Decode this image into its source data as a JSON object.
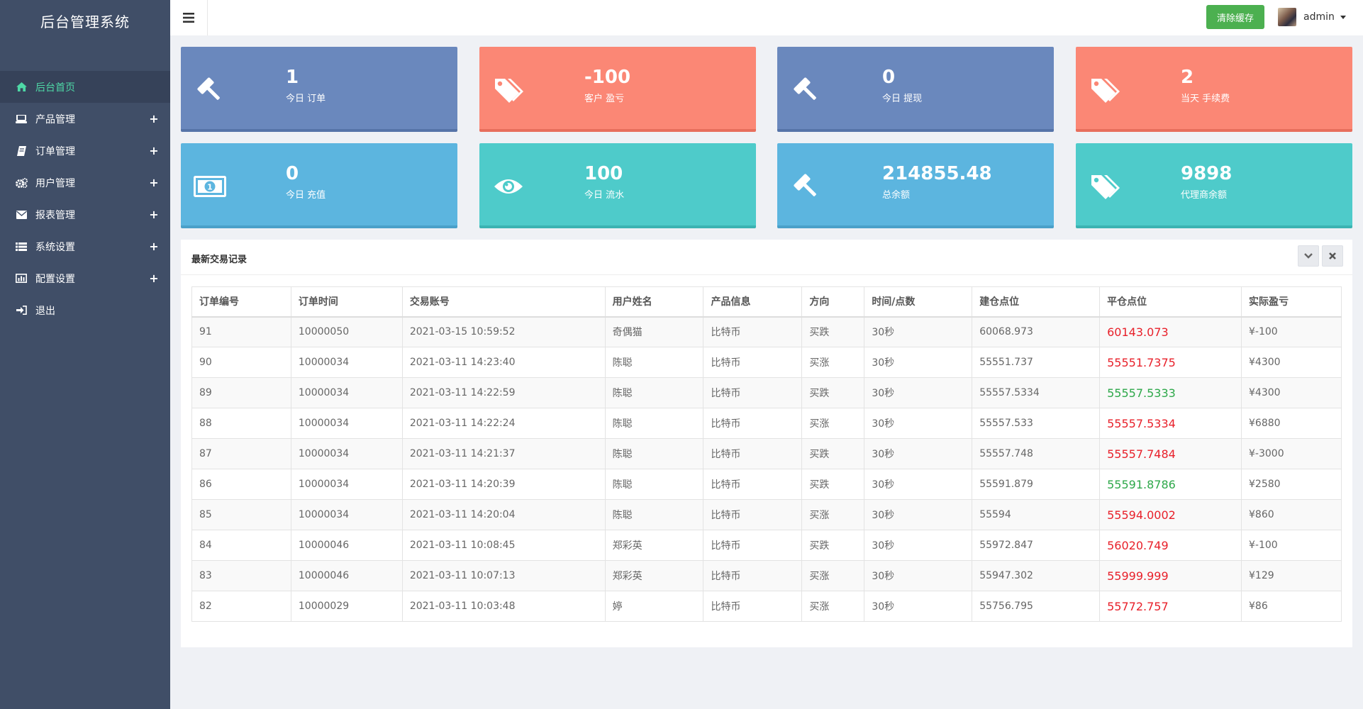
{
  "brand": "后台管理系统",
  "sidebar": {
    "items": [
      {
        "label": "后台首页",
        "icon": "home-icon",
        "active": true,
        "expandable": false
      },
      {
        "label": "产品管理",
        "icon": "laptop-icon",
        "active": false,
        "expandable": true
      },
      {
        "label": "订单管理",
        "icon": "book-icon",
        "active": false,
        "expandable": true
      },
      {
        "label": "用户管理",
        "icon": "gears-icon",
        "active": false,
        "expandable": true
      },
      {
        "label": "报表管理",
        "icon": "envelope-icon",
        "active": false,
        "expandable": true
      },
      {
        "label": "系统设置",
        "icon": "list-icon",
        "active": false,
        "expandable": true
      },
      {
        "label": "配置设置",
        "icon": "bar-chart-icon",
        "active": false,
        "expandable": true
      },
      {
        "label": "退出",
        "icon": "sign-out-icon",
        "active": false,
        "expandable": false
      }
    ],
    "plus": "+"
  },
  "header": {
    "clear_cache": "清除缓存",
    "username": "admin"
  },
  "cards": [
    {
      "value": "1",
      "label": "今日 订单",
      "icon": "gavel-icon",
      "color": "blue"
    },
    {
      "value": "-100",
      "label": "客户 盈亏",
      "icon": "tags-icon",
      "color": "salmon"
    },
    {
      "value": "0",
      "label": "今日 提现",
      "icon": "gavel-icon",
      "color": "blue"
    },
    {
      "value": "2",
      "label": "当天 手续费",
      "icon": "tags-icon",
      "color": "salmon"
    },
    {
      "value": "0",
      "label": "今日 充值",
      "icon": "money-icon",
      "color": "sky"
    },
    {
      "value": "100",
      "label": "今日 流水",
      "icon": "eye-icon",
      "color": "teal"
    },
    {
      "value": "214855.48",
      "label": "总余额",
      "icon": "gavel-icon",
      "color": "sky"
    },
    {
      "value": "9898",
      "label": "代理商余额",
      "icon": "tags-icon",
      "color": "teal"
    }
  ],
  "colors": {
    "sidebar_bg": "#404e67",
    "active_text": "#4ed8a6",
    "blue": "#6a88bd",
    "salmon": "#fb8775",
    "sky": "#5cb5df",
    "teal": "#4ecbca",
    "button_green": "#4cb050",
    "loss_red": "#e8202a",
    "gain_green": "#2ea84a"
  },
  "panel": {
    "title": "最新交易记录",
    "columns": [
      "订单编号",
      "订单时间",
      "交易账号",
      "用户姓名",
      "产品信息",
      "方向",
      "时间/点数",
      "建仓点位",
      "平仓点位",
      "实际盈亏"
    ],
    "rows": [
      [
        "91",
        "10000050",
        "2021-03-15 10:59:52",
        "奇偶猫",
        "比特币",
        "买跌",
        "30秒",
        "60068.973",
        "60143.073",
        "¥-100"
      ],
      [
        "90",
        "10000034",
        "2021-03-11 14:23:40",
        "陈聪",
        "比特币",
        "买涨",
        "30秒",
        "55551.737",
        "55551.7375",
        "¥4300"
      ],
      [
        "89",
        "10000034",
        "2021-03-11 14:22:59",
        "陈聪",
        "比特币",
        "买跌",
        "30秒",
        "55557.5334",
        "55557.5333",
        "¥4300"
      ],
      [
        "88",
        "10000034",
        "2021-03-11 14:22:24",
        "陈聪",
        "比特币",
        "买涨",
        "30秒",
        "55557.533",
        "55557.5334",
        "¥6880"
      ],
      [
        "87",
        "10000034",
        "2021-03-11 14:21:37",
        "陈聪",
        "比特币",
        "买跌",
        "30秒",
        "55557.748",
        "55557.7484",
        "¥-3000"
      ],
      [
        "86",
        "10000034",
        "2021-03-11 14:20:39",
        "陈聪",
        "比特币",
        "买跌",
        "30秒",
        "55591.879",
        "55591.8786",
        "¥2580"
      ],
      [
        "85",
        "10000034",
        "2021-03-11 14:20:04",
        "陈聪",
        "比特币",
        "买涨",
        "30秒",
        "55594",
        "55594.0002",
        "¥860"
      ],
      [
        "84",
        "10000046",
        "2021-03-11 10:08:45",
        "郑彩英",
        "比特币",
        "买跌",
        "30秒",
        "55972.847",
        "56020.749",
        "¥-100"
      ],
      [
        "83",
        "10000046",
        "2021-03-11 10:07:13",
        "郑彩英",
        "比特币",
        "买涨",
        "30秒",
        "55947.302",
        "55999.999",
        "¥129"
      ],
      [
        "82",
        "10000029",
        "2021-03-11 10:03:48",
        "婷",
        "比特币",
        "买涨",
        "30秒",
        "55756.795",
        "55772.757",
        "¥86"
      ]
    ],
    "close_colors": [
      "red",
      "red",
      "green",
      "red",
      "red",
      "green",
      "red",
      "red",
      "red",
      "red"
    ]
  }
}
